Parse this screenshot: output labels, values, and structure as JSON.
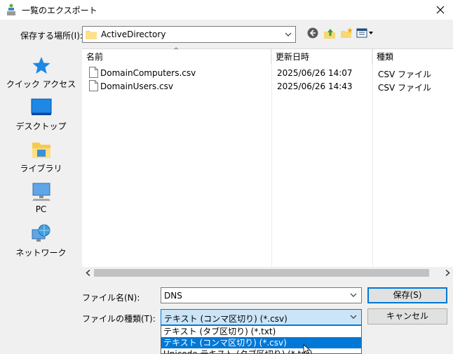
{
  "window": {
    "title": "一覧のエクスポート"
  },
  "location": {
    "label": "保存する場所(I):",
    "value": "ActiveDirectory"
  },
  "toolbar_icons": [
    "back-icon",
    "up-folder-icon",
    "new-folder-icon",
    "view-menu-icon"
  ],
  "places": [
    {
      "label": "クイック アクセス",
      "icon": "star-icon"
    },
    {
      "label": "デスクトップ",
      "icon": "desktop-icon"
    },
    {
      "label": "ライブラリ",
      "icon": "library-icon"
    },
    {
      "label": "PC",
      "icon": "pc-icon"
    },
    {
      "label": "ネットワーク",
      "icon": "network-icon"
    }
  ],
  "file_list": {
    "columns": [
      "名前",
      "更新日時",
      "種類"
    ],
    "rows": [
      {
        "name": "DomainComputers.csv",
        "modified": "2025/06/26 14:07",
        "type": "CSV ファイル"
      },
      {
        "name": "DomainUsers.csv",
        "modified": "2025/06/26 14:43",
        "type": "CSV ファイル"
      }
    ]
  },
  "filename": {
    "label": "ファイル名(N):",
    "value": "DNS"
  },
  "filetype": {
    "label": "ファイルの種類(T):",
    "value": "テキスト (コンマ区切り) (*.csv)",
    "options": [
      "テキスト (タブ区切り) (*.txt)",
      "テキスト (コンマ区切り) (*.csv)",
      "Unicode テキスト (タブ区切り) (*.txt)"
    ],
    "selected_index": 1
  },
  "buttons": {
    "save": "保存(S)",
    "cancel": "キャンセル"
  },
  "colors": {
    "accent": "#0078d7",
    "selection_bg": "#cce4f7"
  }
}
